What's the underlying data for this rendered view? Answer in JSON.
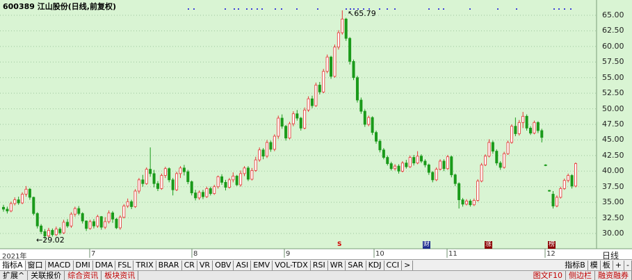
{
  "chart": {
    "title": "600389 江山股份(日线,前复权)",
    "price_axis_ticks": [
      "65.00",
      "62.50",
      "60.00",
      "57.50",
      "55.00",
      "52.50",
      "50.00",
      "47.50",
      "45.00",
      "42.50",
      "40.00",
      "37.50",
      "35.00",
      "32.50",
      "30.00"
    ],
    "peak_label": "65.79",
    "trough_label": "29.02",
    "year_label": "2021年",
    "month_labels": [
      "7",
      "8",
      "9",
      "10",
      "11",
      "12"
    ],
    "event_markers": [
      {
        "text": "S",
        "color": "#d00000"
      },
      {
        "text": "财",
        "color": "#1f2f8f"
      },
      {
        "text": "涨",
        "color": "#8b0000"
      },
      {
        "text": "榜",
        "color": "#8b0000"
      }
    ],
    "period_label": "日线"
  },
  "chart_data": {
    "type": "candlestick",
    "title": "600389 江山股份(日线,前复权)",
    "ylim": [
      28.5,
      66.5
    ],
    "y_ticks": [
      30.0,
      32.5,
      35.0,
      37.5,
      40.0,
      42.5,
      45.0,
      47.5,
      50.0,
      52.5,
      55.0,
      57.5,
      60.0,
      62.5,
      65.0
    ],
    "up_color": "#e63232",
    "down_color": "#1a9a1a",
    "max_price": 65.79,
    "min_price": 29.02,
    "candles": [
      [
        34.2,
        33.9,
        34.6,
        33.5
      ],
      [
        33.9,
        33.6,
        34.3,
        33.2
      ],
      [
        33.6,
        34.8,
        35.1,
        33.4
      ],
      [
        34.8,
        35.4,
        35.8,
        34.5
      ],
      [
        35.4,
        34.9,
        35.9,
        34.6
      ],
      [
        34.9,
        36.3,
        36.6,
        34.7
      ],
      [
        36.3,
        37.1,
        37.6,
        35.9
      ],
      [
        37.1,
        35.8,
        37.3,
        35.4
      ],
      [
        35.8,
        33.2,
        35.9,
        32.9
      ],
      [
        33.2,
        31.2,
        33.4,
        30.8
      ],
      [
        31.2,
        30.3,
        31.5,
        29.9
      ],
      [
        30.3,
        29.6,
        30.7,
        29.02
      ],
      [
        29.6,
        30.5,
        30.9,
        29.4
      ],
      [
        30.5,
        29.8,
        30.8,
        29.5
      ],
      [
        29.8,
        30.7,
        31.1,
        29.6
      ],
      [
        30.7,
        30.1,
        31.0,
        29.8
      ],
      [
        30.1,
        31.8,
        32.2,
        29.9
      ],
      [
        31.8,
        31.2,
        32.3,
        30.9
      ],
      [
        31.2,
        33.1,
        33.4,
        30.9
      ],
      [
        33.1,
        34.0,
        34.3,
        32.7
      ],
      [
        34.0,
        33.2,
        34.4,
        32.9
      ],
      [
        33.2,
        32.0,
        33.4,
        31.6
      ],
      [
        32.0,
        30.8,
        32.1,
        30.4
      ],
      [
        30.8,
        31.9,
        32.2,
        30.6
      ],
      [
        31.9,
        31.2,
        32.3,
        30.8
      ],
      [
        31.2,
        32.7,
        33.0,
        30.9
      ],
      [
        32.7,
        31.0,
        32.8,
        30.6
      ],
      [
        31.0,
        31.9,
        32.6,
        30.7
      ],
      [
        31.9,
        33.3,
        33.7,
        31.6
      ],
      [
        33.3,
        32.3,
        33.6,
        31.7
      ],
      [
        32.3,
        30.9,
        32.5,
        30.7
      ],
      [
        30.9,
        32.6,
        32.9,
        30.6
      ],
      [
        32.6,
        34.4,
        34.7,
        32.4
      ],
      [
        34.4,
        35.1,
        35.6,
        34.1
      ],
      [
        35.1,
        34.3,
        35.4,
        33.9
      ],
      [
        34.3,
        36.8,
        37.1,
        34.1
      ],
      [
        36.8,
        38.6,
        38.9,
        36.4
      ],
      [
        38.6,
        38.0,
        39.4,
        37.5
      ],
      [
        38.0,
        40.3,
        40.6,
        37.8
      ],
      [
        40.3,
        39.6,
        43.8,
        39.1
      ],
      [
        39.6,
        38.0,
        40.2,
        37.4
      ],
      [
        38.0,
        37.2,
        38.4,
        36.8
      ],
      [
        37.2,
        39.3,
        39.6,
        37.0
      ],
      [
        39.3,
        40.4,
        40.7,
        38.9
      ],
      [
        40.4,
        38.6,
        40.6,
        38.2
      ],
      [
        38.6,
        37.0,
        38.9,
        36.1
      ],
      [
        37.0,
        39.6,
        39.9,
        36.8
      ],
      [
        39.6,
        40.5,
        40.8,
        38.9
      ],
      [
        40.5,
        39.9,
        41.0,
        39.3
      ],
      [
        39.9,
        38.3,
        40.2,
        37.9
      ],
      [
        38.3,
        36.5,
        38.5,
        36.1
      ],
      [
        36.5,
        35.7,
        37.0,
        35.3
      ],
      [
        35.7,
        36.6,
        36.9,
        35.4
      ],
      [
        36.6,
        35.9,
        37.0,
        35.5
      ],
      [
        35.9,
        37.2,
        37.5,
        35.7
      ],
      [
        37.2,
        36.4,
        37.5,
        36.1
      ],
      [
        36.4,
        37.5,
        37.8,
        36.2
      ],
      [
        37.5,
        39.1,
        39.3,
        37.2
      ],
      [
        39.1,
        38.2,
        39.5,
        37.8
      ],
      [
        38.2,
        37.4,
        38.6,
        36.9
      ],
      [
        37.4,
        38.6,
        38.9,
        37.2
      ],
      [
        38.6,
        39.2,
        39.8,
        38.2
      ],
      [
        39.2,
        37.8,
        39.4,
        37.6
      ],
      [
        37.8,
        39.6,
        40.1,
        37.5
      ],
      [
        39.6,
        40.5,
        40.8,
        39.2
      ],
      [
        40.5,
        38.7,
        40.8,
        38.4
      ],
      [
        38.7,
        40.1,
        40.5,
        38.5
      ],
      [
        40.1,
        41.8,
        42.3,
        39.9
      ],
      [
        41.8,
        43.4,
        43.8,
        41.5
      ],
      [
        43.4,
        42.4,
        43.7,
        41.9
      ],
      [
        42.4,
        44.6,
        45.0,
        42.1
      ],
      [
        44.6,
        43.5,
        44.9,
        43.1
      ],
      [
        43.5,
        45.6,
        45.9,
        43.2
      ],
      [
        45.6,
        48.5,
        48.9,
        45.2
      ],
      [
        48.5,
        47.2,
        49.1,
        46.8
      ],
      [
        47.2,
        45.3,
        47.4,
        44.9
      ],
      [
        45.3,
        47.6,
        47.9,
        45.1
      ],
      [
        47.6,
        49.2,
        49.6,
        47.2
      ],
      [
        49.2,
        48.5,
        49.8,
        48.1
      ],
      [
        48.5,
        46.9,
        48.7,
        46.5
      ],
      [
        46.9,
        49.8,
        50.2,
        46.7
      ],
      [
        49.8,
        51.6,
        52.0,
        49.5
      ],
      [
        51.6,
        50.5,
        52.1,
        50.1
      ],
      [
        50.5,
        53.8,
        54.2,
        50.3
      ],
      [
        53.8,
        52.7,
        54.3,
        52.3
      ],
      [
        52.7,
        56.0,
        56.4,
        52.5
      ],
      [
        56.0,
        58.3,
        58.7,
        55.7
      ],
      [
        58.3,
        55.2,
        58.5,
        54.8
      ],
      [
        55.2,
        59.9,
        60.3,
        55.0
      ],
      [
        59.9,
        62.2,
        62.6,
        59.5
      ],
      [
        62.2,
        64.4,
        65.79,
        61.9
      ],
      [
        64.4,
        61.3,
        64.6,
        60.9
      ],
      [
        61.3,
        57.6,
        61.5,
        57.1
      ],
      [
        57.6,
        55.0,
        57.9,
        54.6
      ],
      [
        55.0,
        51.4,
        55.3,
        51.0
      ],
      [
        51.4,
        49.6,
        51.8,
        49.2
      ],
      [
        49.6,
        47.5,
        49.9,
        47.1
      ],
      [
        47.5,
        48.6,
        48.9,
        47.2
      ],
      [
        48.6,
        46.2,
        48.8,
        45.8
      ],
      [
        46.2,
        44.8,
        46.5,
        44.4
      ],
      [
        44.8,
        43.4,
        45.1,
        43.0
      ],
      [
        43.4,
        42.2,
        43.7,
        41.9
      ],
      [
        42.2,
        41.2,
        42.5,
        40.9
      ],
      [
        41.2,
        40.4,
        41.5,
        40.1
      ],
      [
        40.4,
        40.8,
        41.1,
        40.1
      ],
      [
        40.8,
        40.0,
        41.1,
        39.6
      ],
      [
        40.0,
        41.3,
        41.6,
        39.8
      ],
      [
        41.3,
        40.7,
        41.8,
        40.4
      ],
      [
        40.7,
        42.2,
        42.5,
        40.5
      ],
      [
        42.2,
        41.3,
        42.6,
        40.9
      ],
      [
        41.3,
        42.4,
        43.2,
        41.1
      ],
      [
        42.4,
        41.6,
        42.7,
        41.3
      ],
      [
        41.6,
        41.0,
        41.9,
        40.6
      ],
      [
        41.0,
        39.8,
        41.2,
        39.4
      ],
      [
        39.8,
        38.6,
        40.0,
        38.2
      ],
      [
        38.6,
        40.3,
        40.6,
        38.4
      ],
      [
        40.3,
        41.6,
        41.9,
        40.1
      ],
      [
        41.6,
        40.4,
        41.9,
        40.0
      ],
      [
        40.4,
        42.3,
        42.6,
        40.2
      ],
      [
        42.3,
        39.4,
        42.5,
        39.0
      ],
      [
        39.4,
        38.0,
        39.6,
        37.6
      ],
      [
        38.0,
        35.4,
        38.2,
        34.0
      ],
      [
        35.4,
        34.7,
        35.7,
        34.3
      ],
      [
        34.7,
        35.2,
        35.5,
        34.5
      ],
      [
        35.2,
        34.6,
        35.5,
        34.3
      ],
      [
        34.6,
        35.3,
        35.6,
        34.4
      ],
      [
        35.3,
        38.4,
        38.7,
        35.1
      ],
      [
        38.4,
        41.0,
        41.3,
        38.2
      ],
      [
        41.0,
        42.4,
        42.7,
        40.8
      ],
      [
        42.4,
        44.6,
        45.1,
        42.2
      ],
      [
        44.6,
        43.2,
        44.9,
        42.8
      ],
      [
        43.2,
        41.3,
        43.5,
        40.9
      ],
      [
        41.3,
        40.6,
        41.6,
        40.2
      ],
      [
        40.6,
        42.8,
        43.1,
        40.4
      ],
      [
        42.8,
        44.6,
        44.9,
        42.6
      ],
      [
        44.6,
        47.2,
        47.5,
        44.4
      ],
      [
        47.2,
        46.0,
        48.6,
        45.6
      ],
      [
        46.0,
        47.8,
        48.2,
        45.7
      ],
      [
        47.8,
        48.8,
        49.5,
        46.9
      ],
      [
        48.8,
        46.9,
        49.1,
        46.5
      ],
      [
        46.9,
        46.1,
        47.2,
        45.8
      ],
      [
        46.1,
        47.8,
        48.1,
        45.9
      ],
      [
        47.8,
        46.5,
        48.0,
        46.1
      ],
      [
        46.5,
        45.4,
        46.8,
        44.6
      ],
      [
        41.0,
        40.9,
        41.1,
        40.8
      ],
      [
        36.9,
        36.8,
        37.0,
        36.7
      ],
      [
        36.3,
        34.4,
        36.8,
        34.0
      ],
      [
        34.4,
        35.8,
        36.1,
        34.2
      ],
      [
        35.8,
        37.2,
        37.5,
        35.6
      ],
      [
        37.2,
        38.5,
        38.8,
        37.0
      ],
      [
        38.5,
        39.3,
        39.6,
        38.2
      ],
      [
        39.3,
        37.6,
        39.5,
        37.2
      ],
      [
        37.6,
        41.2,
        41.4,
        37.4
      ]
    ],
    "x_labels": [
      "2021年",
      "7",
      "8",
      "9",
      "10",
      "11",
      "12"
    ],
    "annotations": [
      {
        "text": "65.79",
        "type": "high"
      },
      {
        "text": "29.02",
        "type": "low"
      }
    ]
  },
  "toolbar_tabs": [
    "指标A",
    "窗口",
    "MACD",
    "DMI",
    "DMA",
    "FSL",
    "TRIX",
    "BRAR",
    "CR",
    "VR",
    "OBV",
    "ASI",
    "EMV",
    "VOL-TDX",
    "RSI",
    "WR",
    "SAR",
    "KDJ",
    "CCI",
    ">"
  ],
  "toolbar_right": [
    "指标B",
    "模",
    "板",
    "+",
    "-"
  ],
  "bottom_tabs": [
    "扩展^",
    "关联报价",
    "综合资讯",
    "板块资讯"
  ],
  "bottom_right": [
    "图文F10",
    "侧边栏",
    "融资融券"
  ]
}
